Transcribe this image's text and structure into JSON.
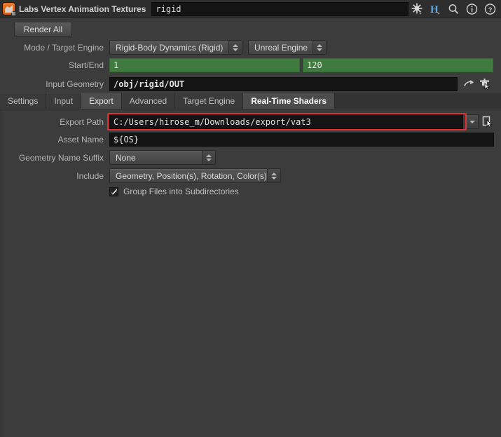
{
  "window": {
    "title": "Labs Vertex Animation Textures",
    "node_name": "rigid",
    "app_icon": "houdini-node-icon",
    "title_icons": [
      {
        "name": "gear-icon",
        "label": "gear"
      },
      {
        "name": "houdini-h-icon",
        "label": "H"
      },
      {
        "name": "search-icon",
        "label": "search"
      },
      {
        "name": "info-icon",
        "label": "info"
      },
      {
        "name": "help-icon",
        "label": "help"
      }
    ]
  },
  "toolbar": {
    "render_all_label": "Render All"
  },
  "parameters": {
    "mode_target_engine": {
      "label": "Mode / Target Engine",
      "mode_value": "Rigid-Body Dynamics (Rigid)",
      "engine_value": "Unreal Engine"
    },
    "start_end": {
      "label": "Start/End",
      "start_value": "1",
      "end_value": "120"
    },
    "input_geometry": {
      "label": "Input Geometry",
      "value": "/obj/rigid/OUT",
      "reload_icon": "reload-arrow-icon",
      "pick_icon": "node-picker-icon"
    },
    "export_path": {
      "label": "Export Path",
      "value": "C:/Users/hirose_m/Downloads/export/vat3",
      "dropdown_icon": "chevron-down-icon",
      "browse_icon": "file-picker-icon",
      "highlight_color": "#e03030"
    },
    "asset_name": {
      "label": "Asset Name",
      "value": "${OS}"
    },
    "geometry_name_suffix": {
      "label": "Geometry Name Suffix",
      "value": "None"
    },
    "include": {
      "label": "Include",
      "value": "Geometry, Position(s), Rotation, Color(s)"
    },
    "group_files": {
      "label": "Group Files into Subdirectories",
      "checked": true
    }
  },
  "tabs": [
    {
      "label": "Settings",
      "state": "normal"
    },
    {
      "label": "Input",
      "state": "normal"
    },
    {
      "label": "Export",
      "state": "selected"
    },
    {
      "label": "Advanced",
      "state": "normal"
    },
    {
      "label": "Target Engine",
      "state": "normal"
    },
    {
      "label": "Real-Time Shaders",
      "state": "current"
    }
  ],
  "colors": {
    "background": "#3c3c3c",
    "titlebar": "#2e2e2e",
    "field_green": "#3f7a3f",
    "field_dark": "#141414",
    "accent_red": "#e03030"
  }
}
